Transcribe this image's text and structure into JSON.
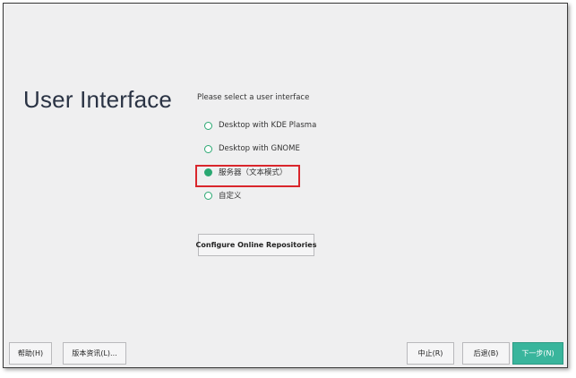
{
  "page": {
    "title": "User Interface"
  },
  "interface_selection": {
    "prompt": "Please select a user interface",
    "options": [
      {
        "label": "Desktop with KDE Plasma",
        "selected": false
      },
      {
        "label": "Desktop with GNOME",
        "selected": false
      },
      {
        "label": "服务器（文本模式）",
        "selected": true
      },
      {
        "label": "自定义",
        "selected": false
      }
    ]
  },
  "buttons": {
    "configure_repos": "Configure Online Repositories",
    "help": "帮助(H)",
    "release_notes": "版本资讯(L)...",
    "abort": "中止(R)",
    "back": "后退(B)",
    "next": "下一步(N)"
  },
  "colors": {
    "accent": "#2aa872",
    "primary_button": "#39b59c",
    "highlight_box": "#d9262c",
    "title": "#2a3344",
    "background": "#efeff0"
  }
}
